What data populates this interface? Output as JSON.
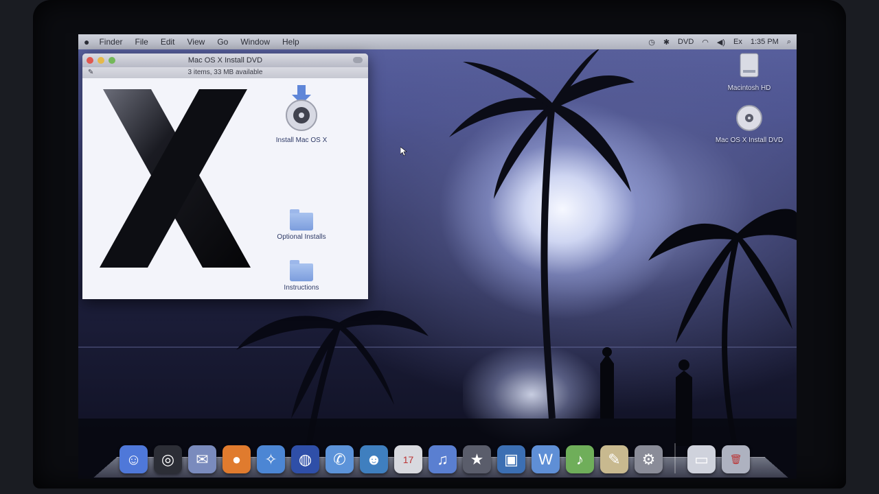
{
  "menubar": {
    "apple": "",
    "items": [
      "Finder",
      "File",
      "Edit",
      "View",
      "Go",
      "Window",
      "Help"
    ],
    "status": {
      "time_machine_icon": "clock-icon",
      "language": "DVD",
      "wifi_icon": "wifi-icon",
      "volume_icon": "speaker-icon",
      "battery": "Ex",
      "clock": "1:35 PM",
      "spotlight_icon": "search-icon"
    }
  },
  "finder": {
    "title": "Mac OS X Install DVD",
    "status": "3 items, 33 MB available",
    "items": [
      {
        "label": "Install Mac OS X"
      },
      {
        "label": "Optional Installs"
      },
      {
        "label": "Instructions"
      }
    ],
    "traffic_colors": [
      "#e0574f",
      "#e6b94a",
      "#74b85a"
    ]
  },
  "desktop": {
    "icons": [
      {
        "label": "Macintosh HD"
      },
      {
        "label": "Mac OS X Install DVD"
      }
    ]
  },
  "dock": {
    "apps": [
      {
        "name": "finder-icon",
        "glyph": "☺",
        "color": "#4f78d9"
      },
      {
        "name": "dashboard-icon",
        "glyph": "◎",
        "color": "#2c2e36"
      },
      {
        "name": "mail-icon",
        "glyph": "✉",
        "color": "#7a8bbd"
      },
      {
        "name": "firefox-icon",
        "glyph": "●",
        "color": "#e07b2e"
      },
      {
        "name": "safari-icon",
        "glyph": "✧",
        "color": "#4c86d4"
      },
      {
        "name": "google-earth-icon",
        "glyph": "◍",
        "color": "#2f4fa8"
      },
      {
        "name": "ichat-icon",
        "glyph": "✆",
        "color": "#5c93d9"
      },
      {
        "name": "address-book-icon",
        "glyph": "☻",
        "color": "#3f7fbf"
      },
      {
        "name": "ical-icon",
        "glyph": "17",
        "color": "#d8d9df"
      },
      {
        "name": "itunes-icon",
        "glyph": "♫",
        "color": "#5a7fd1"
      },
      {
        "name": "imovie-icon",
        "glyph": "★",
        "color": "#5a5d6b"
      },
      {
        "name": "iphoto-icon",
        "glyph": "▣",
        "color": "#3c6fb3"
      },
      {
        "name": "iweb-icon",
        "glyph": "W",
        "color": "#5f8fd6"
      },
      {
        "name": "garageband-icon",
        "glyph": "♪",
        "color": "#6fae5a"
      },
      {
        "name": "preview-icon",
        "glyph": "✎",
        "color": "#c8b98f"
      },
      {
        "name": "system-preferences-icon",
        "glyph": "⚙",
        "color": "#8a8c98"
      }
    ],
    "right": [
      {
        "name": "downloads-stack-icon",
        "glyph": "▭",
        "color": "#cfd2dc"
      },
      {
        "name": "trash-icon",
        "glyph": "🗑",
        "color": "#aeb2c0"
      }
    ]
  }
}
